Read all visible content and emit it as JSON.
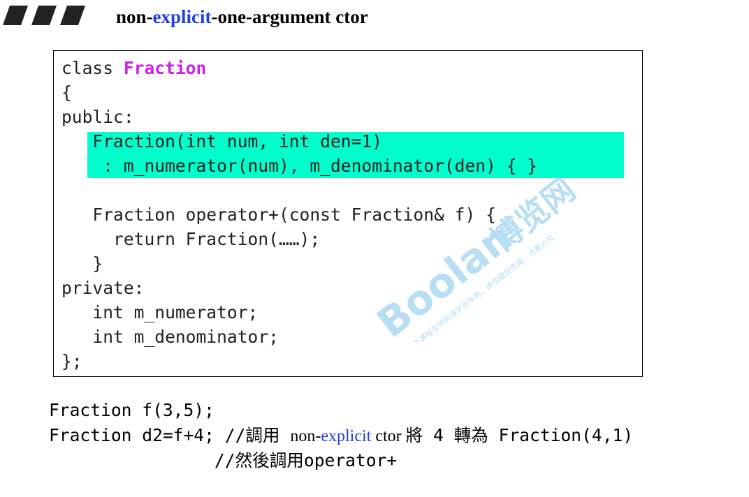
{
  "heading": {
    "prefix": "non-",
    "keyword": "explicit",
    "suffix": "-one-argument ctor"
  },
  "code": {
    "l1_kw": "class ",
    "l1_cls": "Fraction",
    "l2": "{",
    "l3": "public:",
    "l4": "   Fraction(int num, int den=1)",
    "l5": "    : m_numerator(num), m_denominator(den) { }",
    "l6": "",
    "l7": "   Fraction operator+(const Fraction& f) {",
    "l8": "     return Fraction(……);",
    "l9": "   }",
    "l10": "private:",
    "l11": "   int m_numerator;",
    "l12": "   int m_denominator;",
    "l13": "};"
  },
  "usage": {
    "line1": "Fraction f(3,5);",
    "line2_code": "Fraction d2=f+4; //調用 ",
    "line2_non": "non-",
    "line2_explicit": "explicit",
    "line2_ctor": " ctor ",
    "line2_rest": "將 4 轉為 Fraction(4,1)",
    "line3": "                //然後調用operator+"
  },
  "watermark": {
    "logo": "Boolan",
    "cn": "博览网",
    "fine_print": "本课程仅供购课学员专用，请勿擅自传播，违者必究"
  },
  "colors": {
    "highlight": "#00ffcc",
    "keyword_blue": "#1f3fe0",
    "class_magenta": "#cc22e8",
    "watermark": "#7fc4ec"
  }
}
